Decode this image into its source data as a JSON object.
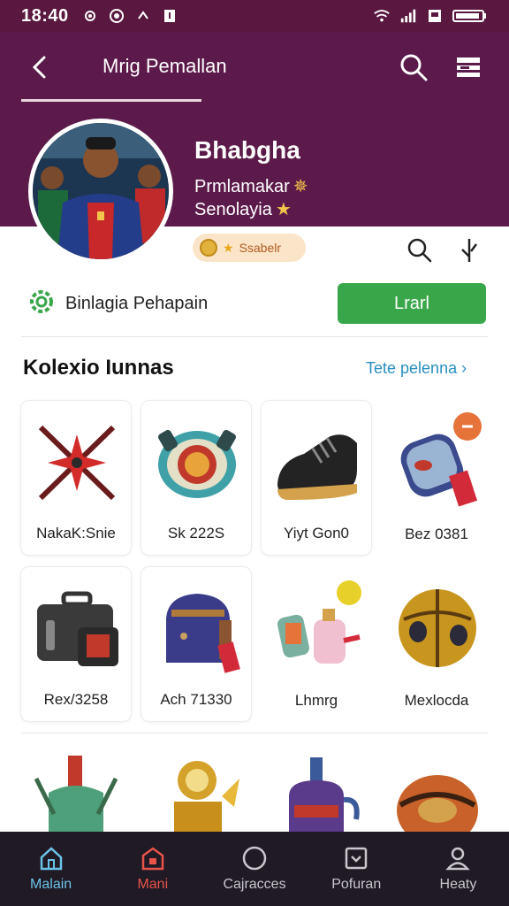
{
  "status": {
    "time": "18:40",
    "icons": [
      "gear-icon",
      "target-icon",
      "arrow-icon",
      "notification-icon"
    ],
    "right_icons": [
      "wifi-icon",
      "signal-icon",
      "sim-icon",
      "battery-icon"
    ]
  },
  "appbar": {
    "title": "Mrig Pemallan"
  },
  "profile": {
    "name": "Bhabgha",
    "line1": "Prmlamakar",
    "line2": "Senolayia",
    "badge_label": "Ssabelr"
  },
  "action": {
    "label": "Binlagia Pehapain",
    "button": "Lrarl"
  },
  "section": {
    "title": "Kolexio Iunnas",
    "see_more": "Tete pelenna"
  },
  "items": [
    {
      "label": "NakaK:Snie",
      "icon": "crossed-swords-icon"
    },
    {
      "label": "Sk 222S",
      "icon": "gear-shield-icon"
    },
    {
      "label": "Yiyt Gon0",
      "icon": "boot-icon"
    },
    {
      "label": "Bez 0381",
      "icon": "bag-tag-icon"
    },
    {
      "label": "Rex/3258",
      "icon": "suitcase-icon"
    },
    {
      "label": "Ach 71330",
      "icon": "backpack-icon"
    },
    {
      "label": "Lhmrg",
      "icon": "potion-icon"
    },
    {
      "label": "Mexlocda",
      "icon": "golden-ball-icon"
    },
    {
      "label": "",
      "icon": "bottle-icon"
    },
    {
      "label": "",
      "icon": "trophy-icon"
    },
    {
      "label": "",
      "icon": "teapot-icon"
    },
    {
      "label": "",
      "icon": "rugby-ball-icon"
    }
  ],
  "nav": [
    {
      "label": "Malain",
      "icon": "home-icon"
    },
    {
      "label": "Mani",
      "icon": "shop-icon"
    },
    {
      "label": "Cajracces",
      "icon": "circle-icon"
    },
    {
      "label": "Pofuran",
      "icon": "inbox-icon"
    },
    {
      "label": "Heaty",
      "icon": "profile-icon"
    }
  ],
  "colors": {
    "header": "#5c1a4a",
    "status": "#5a1840",
    "primary_button": "#3aa64a",
    "link": "#2a8fc0",
    "nav_bg": "#1f1a24",
    "nav_active_blue": "#6cc3ea",
    "nav_active_red": "#e8534a"
  }
}
